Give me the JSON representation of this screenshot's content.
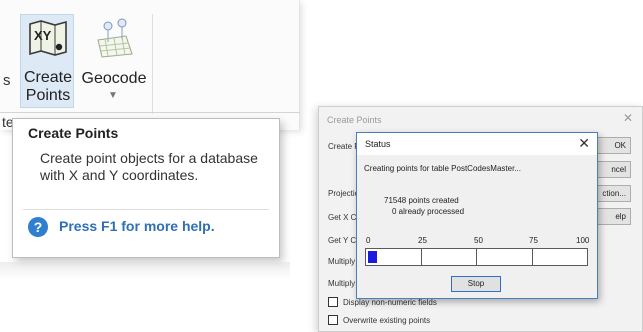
{
  "ribbon": {
    "left_partial_text": "s",
    "left_partial_text_2": "te",
    "create_points": {
      "label_line1": "Create",
      "label_line2": "Points",
      "icon_text": "XY"
    },
    "geocode": {
      "label": "Geocode"
    }
  },
  "tooltip": {
    "title": "Create Points",
    "body": "Create point objects for a database with X and Y coordinates.",
    "help_text": "Press F1 for more help.",
    "help_icon_glyph": "?"
  },
  "create_points_dialog": {
    "title": "Create Points",
    "close_glyph": "✕",
    "labels": {
      "create": "Create P",
      "projection": "Projectio",
      "get_x": "Get X Co",
      "get_y": "Get Y Co",
      "multiply1": "Multiply",
      "multiply2": "Multiply"
    },
    "buttons": {
      "ok": "OK",
      "cancel": "ncel",
      "projection": "ction...",
      "help": "elp"
    },
    "checkboxes": [
      {
        "label": "Display non-numeric fields",
        "checked": false
      },
      {
        "label": "Overwrite existing points",
        "checked": false
      }
    ]
  },
  "status_dialog": {
    "title": "Status",
    "close_glyph": "✕",
    "message": "Creating points for table PostCodesMaster...",
    "points_created": "71548 points created",
    "already_processed": "0 already processed",
    "ticks": [
      "0",
      "25",
      "50",
      "75",
      "100"
    ],
    "progress_percent": 4,
    "stop_label": "Stop"
  }
}
